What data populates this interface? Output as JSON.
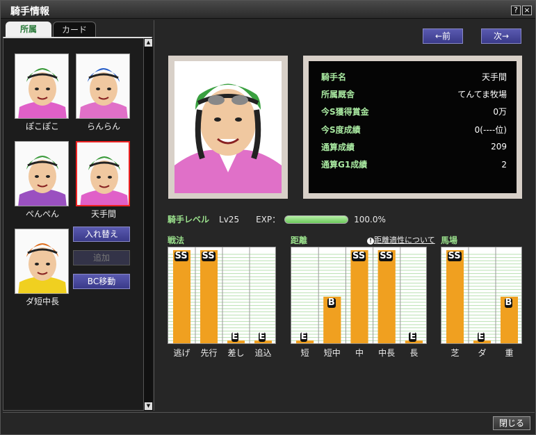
{
  "window": {
    "title": "騎手情報"
  },
  "tabs": [
    {
      "label": "所属"
    },
    {
      "label": "カード"
    }
  ],
  "jockeys": [
    {
      "name": "ぽこぽこ",
      "helmet": "#3a9a3a",
      "silk": "#e060c8"
    },
    {
      "name": "らんらん",
      "helmet": "#2a60c8",
      "silk": "#e070c8"
    },
    {
      "name": "ぺんぺん",
      "helmet": "#3a9a3a",
      "silk": "#9a50c0"
    },
    {
      "name": "天手間",
      "helmet": "#3a9a3a",
      "silk": "#e060c8"
    },
    {
      "name": "ダ短中長",
      "helmet": "#e07020",
      "silk": "#f0d020"
    }
  ],
  "actions": {
    "swap": "入れ替え",
    "add": "追加",
    "bc_move": "BC移動"
  },
  "nav": {
    "prev": "←前",
    "next": "次→"
  },
  "profile": {
    "rows": [
      {
        "label": "騎手名",
        "value": "天手間"
      },
      {
        "label": "所属厩舎",
        "value": "てんてま牧場"
      },
      {
        "label": "今S獲得賞金",
        "value": "0万"
      },
      {
        "label": "今S度成績",
        "value": "0(----位)"
      },
      {
        "label": "通算成績",
        "value": "209"
      },
      {
        "label": "通算G1成績",
        "value": "2"
      }
    ]
  },
  "level": {
    "label": "騎手レベル",
    "lv": "Lv25",
    "exp_label": "EXP：",
    "exp_pct": "100.0%",
    "exp_value": 1.0
  },
  "sections": {
    "tactics": "戦法",
    "distance": "距離",
    "track": "馬場",
    "aptitude_link": "距離適性について"
  },
  "chart_data": [
    {
      "type": "bar",
      "categories": [
        "逃げ",
        "先行",
        "差し",
        "追込"
      ],
      "grades": [
        "SS",
        "SS",
        "E",
        "E"
      ],
      "values": [
        6,
        6,
        0,
        0
      ]
    },
    {
      "type": "bar",
      "categories": [
        "短",
        "短中",
        "中",
        "中長",
        "長"
      ],
      "grades": [
        "E",
        "B",
        "SS",
        "SS",
        "E"
      ],
      "values": [
        0,
        3,
        6,
        6,
        0
      ]
    },
    {
      "type": "bar",
      "categories": [
        "芝",
        "ダ",
        "重"
      ],
      "grades": [
        "SS",
        "E",
        "B"
      ],
      "values": [
        6,
        0,
        3
      ]
    }
  ],
  "close": "閉じる",
  "colors": {
    "bar": "#f0a020",
    "grid": "#b8e0b0"
  }
}
